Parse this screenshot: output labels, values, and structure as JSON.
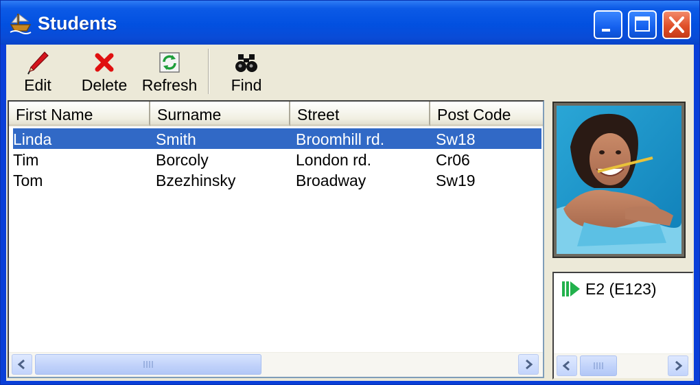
{
  "window": {
    "title": "Students",
    "icons": {
      "app": "ship-icon",
      "minimize": "minimize-icon",
      "maximize": "maximize-icon",
      "close": "close-icon"
    }
  },
  "toolbar": {
    "edit_label": "Edit",
    "delete_label": "Delete",
    "refresh_label": "Refresh",
    "find_label": "Find",
    "icons": {
      "edit": "pencil-icon",
      "delete": "red-x-icon",
      "refresh": "refresh-icon",
      "find": "binoculars-icon"
    }
  },
  "list": {
    "columns": [
      "First Name",
      "Surname",
      "Street",
      "Post Code"
    ],
    "rows": [
      {
        "first_name": "Linda",
        "surname": "Smith",
        "street": "Broomhill rd.",
        "post_code": "Sw18",
        "selected": true
      },
      {
        "first_name": "Tim",
        "surname": "Borcoly",
        "street": "London rd.",
        "post_code": "Cr06",
        "selected": false
      },
      {
        "first_name": "Tom",
        "surname": "Bzezhinsky",
        "street": "Broadway",
        "post_code": "Sw19",
        "selected": false
      }
    ]
  },
  "side_panel": {
    "photo": "student-photo",
    "info_item": "E2 (E123)",
    "info_icon": "go-arrow-icon"
  },
  "colors": {
    "titlebar": "#0250e0",
    "selection": "#3169c6",
    "face": "#ece9d8",
    "go_arrow": "#22b14c"
  }
}
